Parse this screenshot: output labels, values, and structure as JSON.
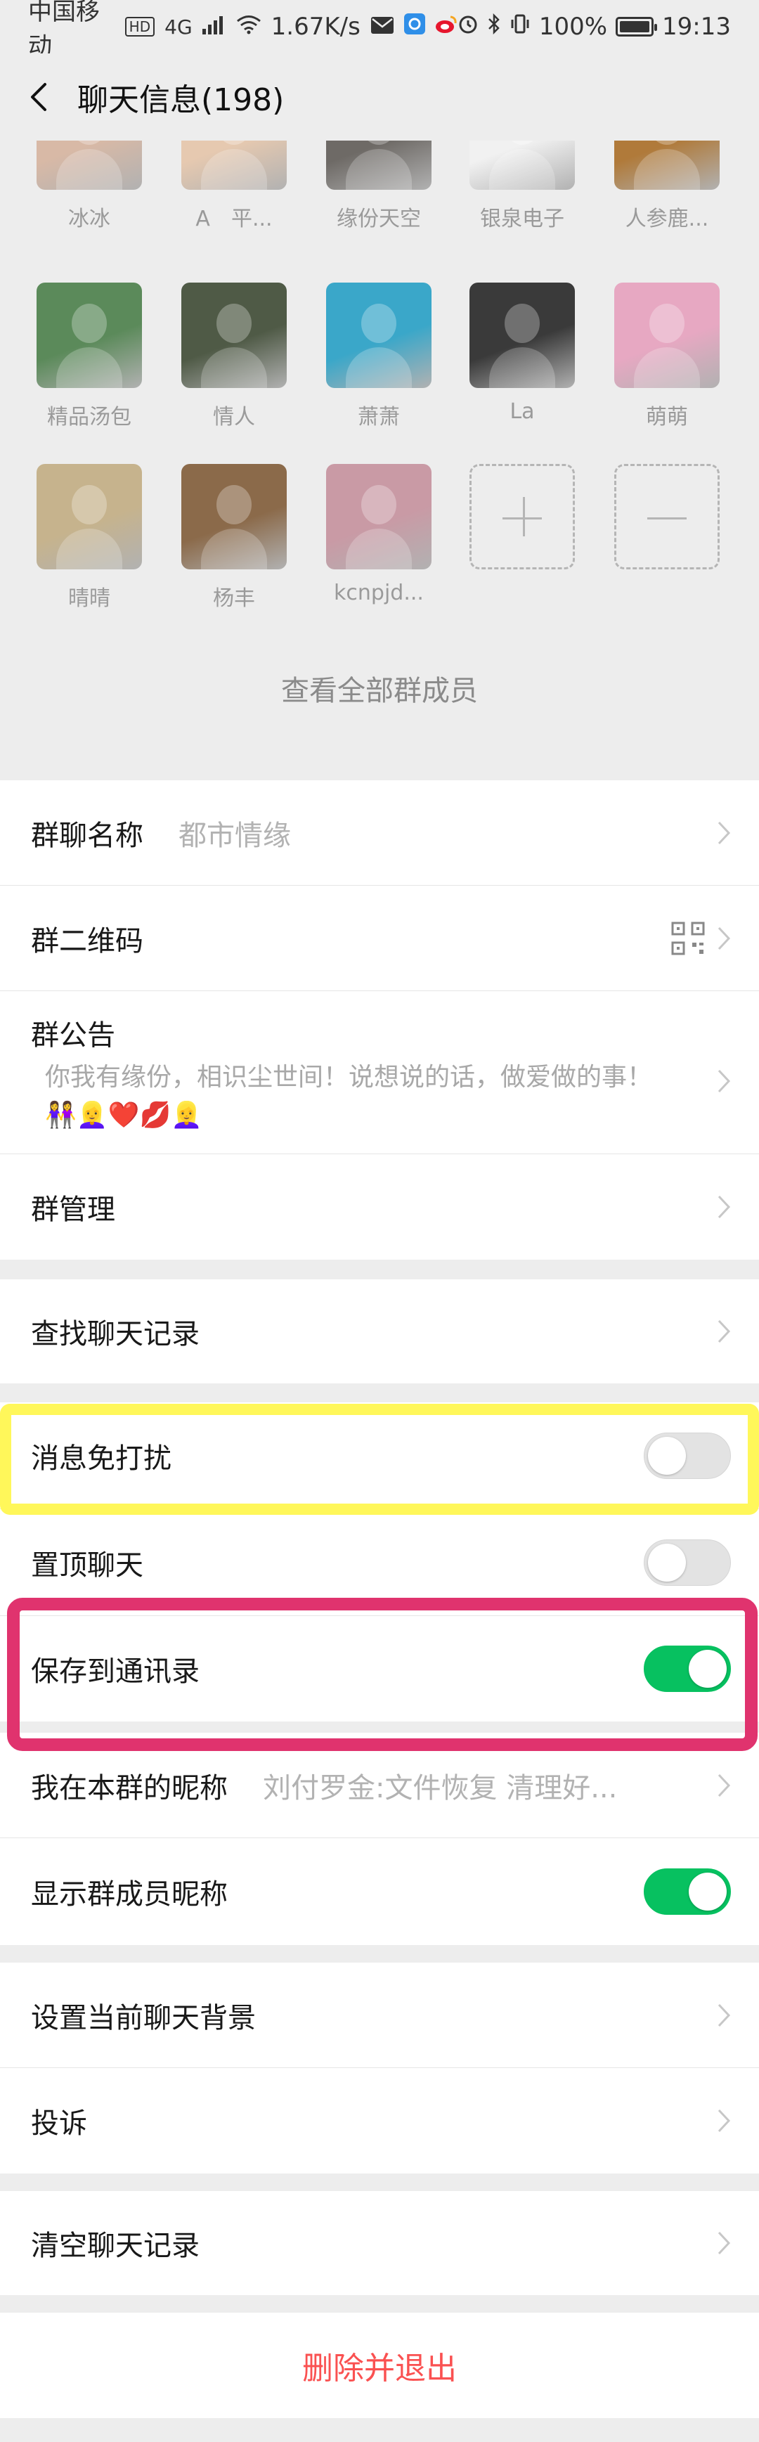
{
  "status_bar": {
    "carrier": "中国移动",
    "hd": "HD",
    "network": "4G",
    "speed": "1.67K/s",
    "battery": "100%",
    "battery_level": 1.0,
    "time": "19:13"
  },
  "nav": {
    "title": "聊天信息(198)"
  },
  "members": [
    {
      "name": "冰冰",
      "color": "#d8b9a6"
    },
    {
      "name": "A　平...",
      "color": "#e6c9b0"
    },
    {
      "name": "缘份天空",
      "color": "#6e6a66"
    },
    {
      "name": "银泉电子",
      "color": "#f1f1f1"
    },
    {
      "name": "人参鹿...",
      "color": "#b07a3a"
    },
    {
      "name": "精品汤包",
      "color": "#5b8a5a"
    },
    {
      "name": "情人",
      "color": "#4f5a46"
    },
    {
      "name": "萧萧",
      "color": "#3aa7c9"
    },
    {
      "name": "La",
      "color": "#3a3a3a"
    },
    {
      "name": "萌萌",
      "color": "#e7a8c2"
    },
    {
      "name": "晴晴",
      "color": "#c6b38d"
    },
    {
      "name": "杨丰",
      "color": "#8b6a4a"
    },
    {
      "name": "kcnpjd...",
      "color": "#c99aa5"
    }
  ],
  "view_all": "查看全部群成员",
  "settings": {
    "group_name_label": "群聊名称",
    "group_name_value": "都市情缘",
    "qr_label": "群二维码",
    "notice_label": "群公告",
    "notice_text": "你我有缘份，相识尘世间！说想说的话，做爱做的事！👭👱‍♀️❤️💋👱‍♀️",
    "manage_label": "群管理",
    "search_label": "查找聊天记录",
    "mute_label": "消息免打扰",
    "mute_on": false,
    "pin_label": "置顶聊天",
    "pin_on": false,
    "save_label": "保存到通讯录",
    "save_on": true,
    "nickname_label": "我在本群的昵称",
    "nickname_value": "刘付罗金:文件恢复 清理好...",
    "show_nick_label": "显示群成员昵称",
    "show_nick_on": true,
    "background_label": "设置当前聊天背景",
    "report_label": "投诉",
    "clear_label": "清空聊天记录",
    "exit_label": "删除并退出"
  }
}
